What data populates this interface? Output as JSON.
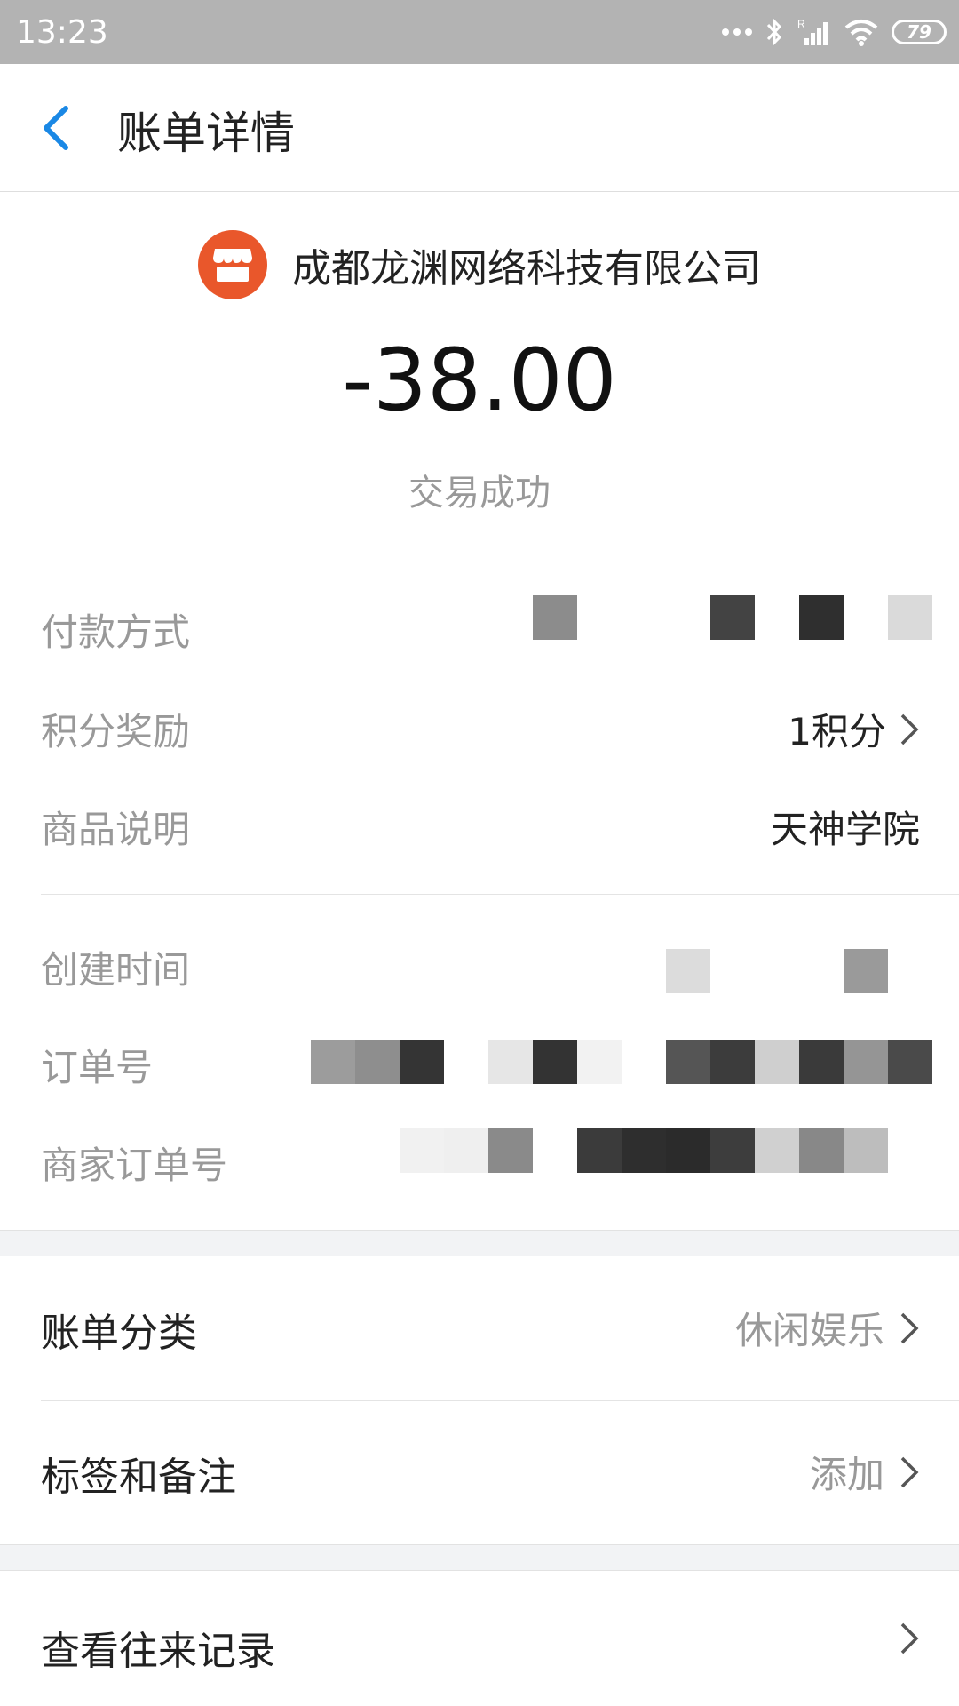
{
  "status_bar": {
    "time": "13:23",
    "battery": "79",
    "icons": [
      "more-dots-icon",
      "bluetooth-icon",
      "signal-icon",
      "wifi-icon",
      "battery-icon"
    ]
  },
  "nav": {
    "title": "账单详情",
    "back_icon": "back-chevron-icon",
    "accent": "#1a88e5"
  },
  "transaction": {
    "merchant_name": "成都龙渊网络科技有限公司",
    "merchant_icon": "store-icon",
    "merchant_icon_color": "#e9572b",
    "amount": "-38.00",
    "status": "交易成功"
  },
  "details": {
    "payment_method_label": "付款方式",
    "points_label": "积分奖励",
    "points_value": "1积分",
    "product_label": "商品说明",
    "product_value": "天神学院",
    "created_time_label": "创建时间",
    "order_no_label": "订单号",
    "merchant_order_no_label": "商家订单号"
  },
  "actions": {
    "category_label": "账单分类",
    "category_value": "休闲娱乐",
    "tags_label": "标签和备注",
    "tags_value": "添加",
    "history_label": "查看往来记录"
  }
}
